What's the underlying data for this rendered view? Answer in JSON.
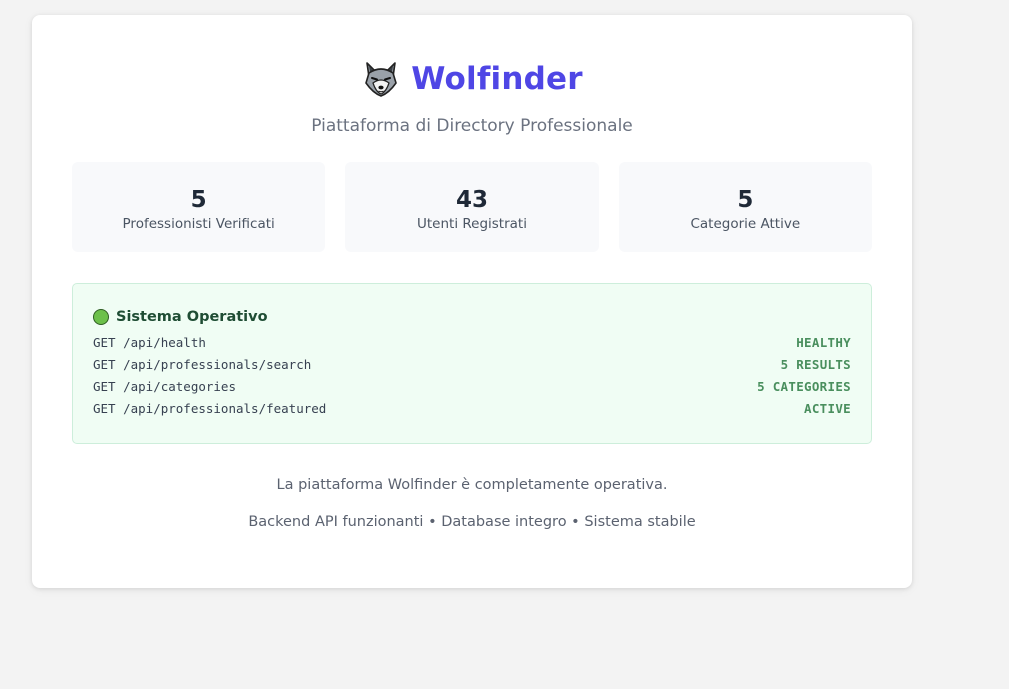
{
  "app": {
    "title": "Wolfinder",
    "subtitle": "Piattaforma di Directory Professionale",
    "logo_icon": "wolf-face-icon",
    "accent_color": "#4f46e5"
  },
  "stats": [
    {
      "value": "5",
      "label": "Professionisti Verificati"
    },
    {
      "value": "43",
      "label": "Utenti Registrati"
    },
    {
      "value": "5",
      "label": "Categorie Attive"
    }
  ],
  "system_status": {
    "indicator_icon": "green-circle-icon",
    "indicator_color": "#6cc04a",
    "title": "Sistema Operativo",
    "endpoints": [
      {
        "path": "GET /api/health",
        "status": "HEALTHY"
      },
      {
        "path": "GET /api/professionals/search",
        "status": "5 RESULTS"
      },
      {
        "path": "GET /api/categories",
        "status": "5 CATEGORIES"
      },
      {
        "path": "GET /api/professionals/featured",
        "status": "ACTIVE"
      }
    ]
  },
  "footer": {
    "line1": "La piattaforma Wolfinder è completamente operativa.",
    "line2": "Backend API funzionanti • Database integro • Sistema stabile"
  }
}
